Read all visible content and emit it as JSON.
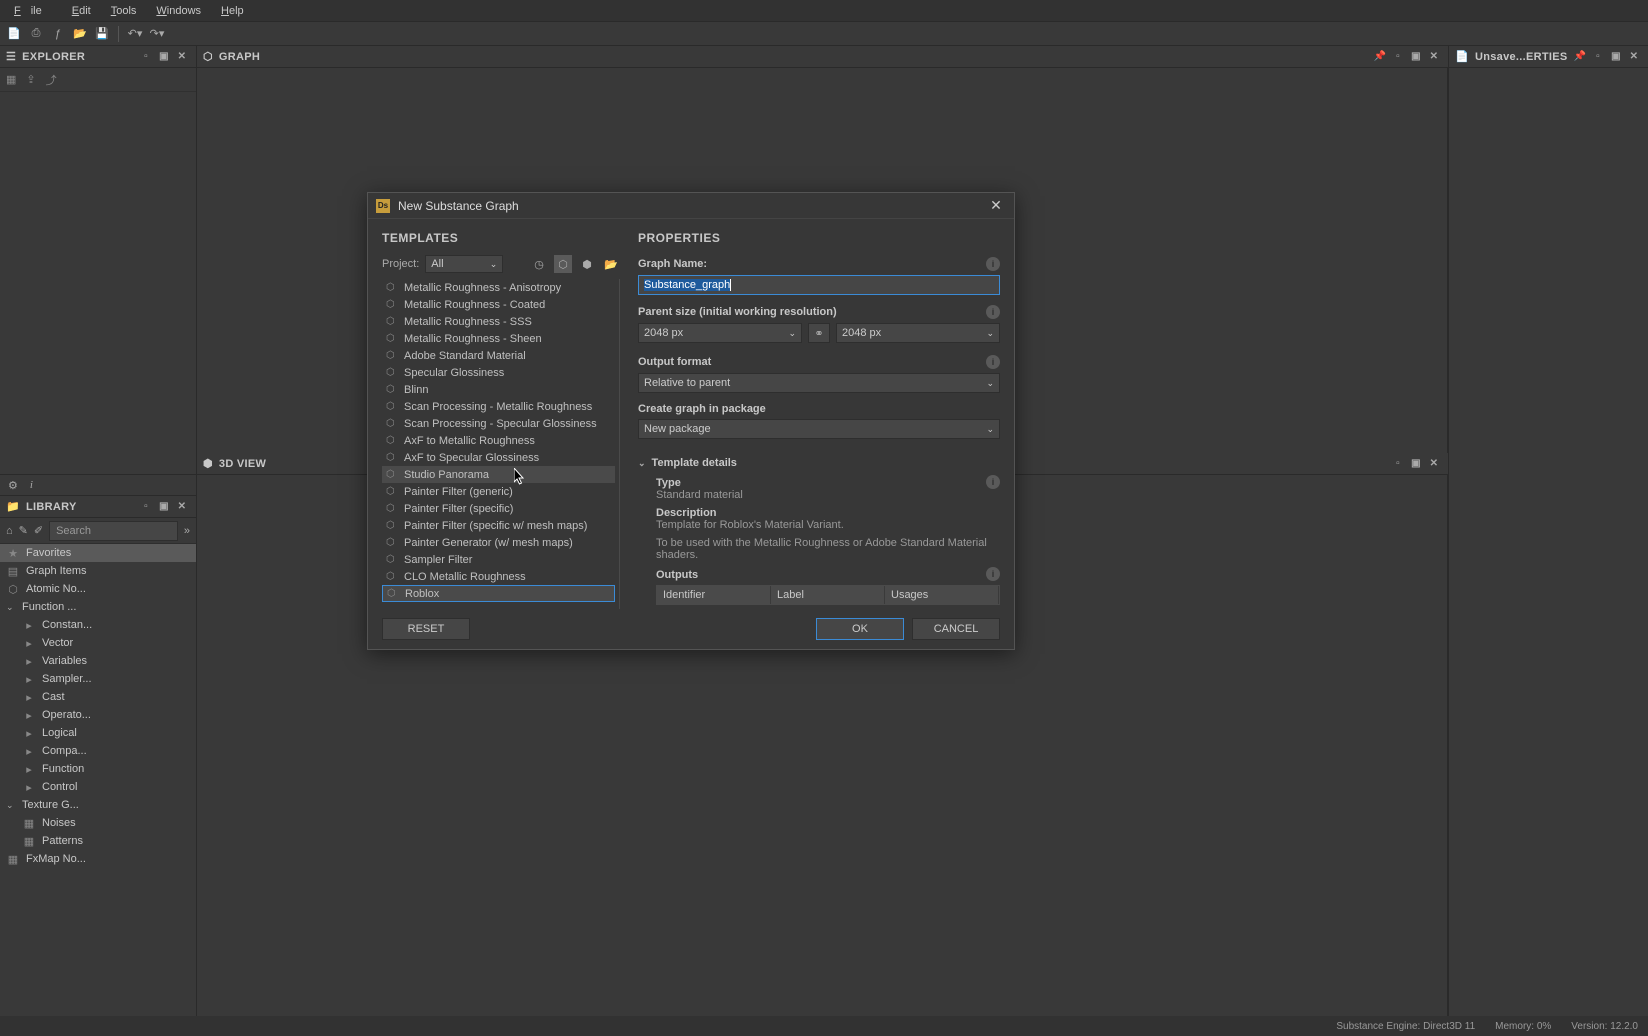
{
  "menu": {
    "file": "File",
    "edit": "Edit",
    "tools": "Tools",
    "windows": "Windows",
    "help": "Help"
  },
  "panels": {
    "explorer": "EXPLORER",
    "graph": "GRAPH",
    "library": "LIBRARY",
    "view3d": "3D VIEW",
    "properties": "Unsave...ERTIES"
  },
  "library": {
    "search_placeholder": "Search",
    "tree": [
      {
        "label": "Favorites",
        "type": "header",
        "icon": "star",
        "selected": true
      },
      {
        "label": "Graph Items",
        "type": "header",
        "icon": "chat"
      },
      {
        "label": "Atomic No...",
        "type": "header",
        "icon": "atom"
      },
      {
        "label": "Function ...",
        "type": "group",
        "expanded": true
      },
      {
        "label": "Constan...",
        "type": "item",
        "indent": true
      },
      {
        "label": "Vector",
        "type": "item",
        "indent": true
      },
      {
        "label": "Variables",
        "type": "item",
        "indent": true
      },
      {
        "label": "Sampler...",
        "type": "item",
        "indent": true
      },
      {
        "label": "Cast",
        "type": "item",
        "indent": true
      },
      {
        "label": "Operato...",
        "type": "item",
        "indent": true
      },
      {
        "label": "Logical",
        "type": "item",
        "indent": true
      },
      {
        "label": "Compa...",
        "type": "item",
        "indent": true
      },
      {
        "label": "Function",
        "type": "item",
        "indent": true
      },
      {
        "label": "Control",
        "type": "item",
        "indent": true
      },
      {
        "label": "Texture G...",
        "type": "group",
        "expanded": true
      },
      {
        "label": "Noises",
        "type": "item",
        "indent": true,
        "icon": "grid"
      },
      {
        "label": "Patterns",
        "type": "item",
        "indent": true,
        "icon": "grid"
      },
      {
        "label": "FxMap No...",
        "type": "header",
        "icon": "fx"
      }
    ]
  },
  "dialog": {
    "title": "New Substance Graph",
    "templates_title": "TEMPLATES",
    "properties_title": "PROPERTIES",
    "project_label": "Project:",
    "project_value": "All",
    "templates": [
      "Metallic Roughness - Anisotropy",
      "Metallic Roughness - Coated",
      "Metallic Roughness - SSS",
      "Metallic Roughness - Sheen",
      "Adobe Standard Material",
      "Specular Glossiness",
      "Blinn",
      "Scan Processing - Metallic Roughness",
      "Scan Processing - Specular Glossiness",
      "AxF to Metallic Roughness",
      "AxF to Specular Glossiness",
      "Studio Panorama",
      "Painter Filter (generic)",
      "Painter Filter (specific)",
      "Painter Filter (specific w/ mesh maps)",
      "Painter Generator (w/ mesh maps)",
      "Sampler Filter",
      "CLO Metallic Roughness",
      "Roblox"
    ],
    "hover_index": 11,
    "selected_index": 18,
    "graph_name_label": "Graph Name:",
    "graph_name_value": "Substance_graph",
    "parent_size_label": "Parent size (initial working resolution)",
    "size_w": "2048 px",
    "size_h": "2048 px",
    "output_format_label": "Output format",
    "output_format_value": "Relative to parent",
    "package_label": "Create graph in package",
    "package_value": "New package",
    "details_title": "Template details",
    "type_label": "Type",
    "type_value": "Standard material",
    "desc_label": "Description",
    "desc_value1": "Template for Roblox's Material Variant.",
    "desc_value2": "To be used with the Metallic Roughness or Adobe Standard Material shaders.",
    "outputs_label": "Outputs",
    "out_cols": {
      "id": "Identifier",
      "label": "Label",
      "usages": "Usages"
    },
    "reset": "RESET",
    "ok": "OK",
    "cancel": "CANCEL"
  },
  "status": {
    "engine": "Substance Engine: Direct3D 11",
    "memory": "Memory: 0%",
    "version": "Version: 12.2.0"
  }
}
